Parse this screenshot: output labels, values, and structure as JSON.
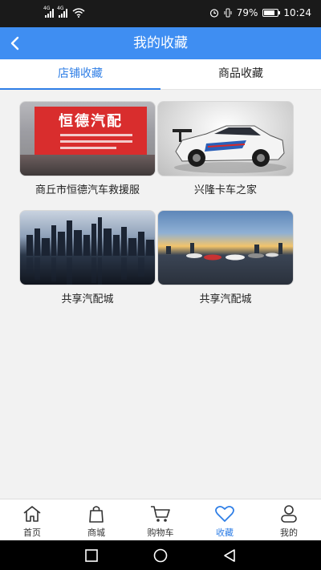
{
  "status_bar": {
    "signal1_tag": "4G",
    "signal2_tag": "4G",
    "battery_percent": "79%",
    "time": "10:24"
  },
  "header": {
    "title": "我的收藏",
    "back_icon": "chevron-left-icon"
  },
  "tabs": [
    {
      "label": "店铺收藏",
      "active": true
    },
    {
      "label": "商品收藏",
      "active": false
    }
  ],
  "favorites": [
    {
      "name": "商丘市恒德汽车救援服",
      "sign_text": "恒德汽配"
    },
    {
      "name": "兴隆卡车之家"
    },
    {
      "name": "共享汽配城"
    },
    {
      "name": "共享汽配城"
    }
  ],
  "bottom_nav": [
    {
      "label": "首页",
      "icon": "home-icon",
      "active": false
    },
    {
      "label": "商城",
      "icon": "shopping-bag-icon",
      "active": false
    },
    {
      "label": "购物车",
      "icon": "cart-icon",
      "active": false
    },
    {
      "label": "收藏",
      "icon": "heart-icon",
      "active": true
    },
    {
      "label": "我的",
      "icon": "user-icon",
      "active": false
    }
  ],
  "colors": {
    "primary": "#3f8ef2",
    "accent": "#2e7ee6",
    "sign_red": "#d92d2d"
  }
}
